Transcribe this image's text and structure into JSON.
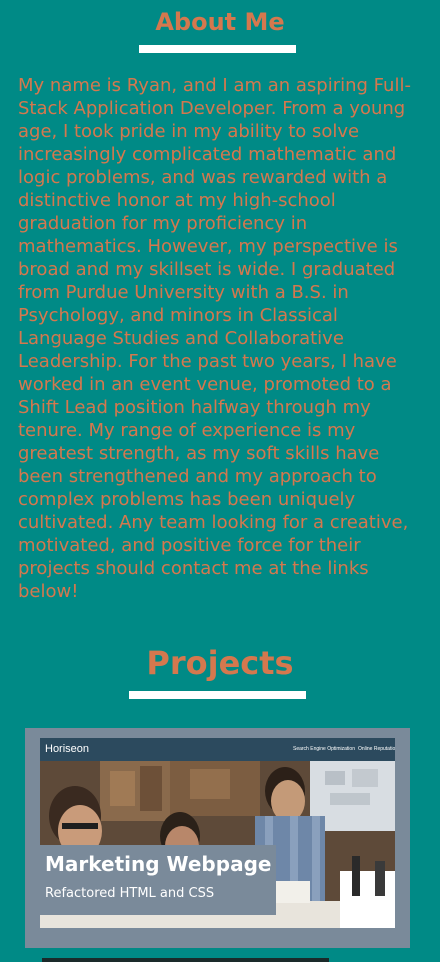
{
  "about": {
    "title": "About Me",
    "text": "My name is Ryan, and I am an aspiring Full-Stack Application Developer. From a young age, I took pride in my ability to solve increasingly complicated mathematic and logic problems, and was rewarded with a distinctive honor at my high-school graduation for my proficiency in mathematics. However, my perspective is broad and my skillset is wide. I graduated from Purdue University with a B.S. in Psychology, and minors in Classical Language Studies and Collaborative Leadership. For the past two years, I have worked in an event venue, promoted to a Shift Lead position halfway through my tenure. My range of experience is my greatest strength, as my soft skills have been strengthened and my approach to complex problems has been uniquely cultivated. Any team looking for a creative, motivated, and positive force for their projects should contact me at the links below!"
  },
  "projects": {
    "title": "Projects",
    "items": [
      {
        "name": "Marketing Webpage",
        "description": "Refactored HTML and CSS",
        "screenshot": {
          "brand": "Horiseon",
          "nav_links": [
            "Search Engine Optimization",
            "Online Reputation Management"
          ]
        }
      }
    ]
  },
  "colors": {
    "background": "#008a86",
    "accent": "#d4784e",
    "underline": "#ffffff",
    "card": "#7a8a9a"
  }
}
